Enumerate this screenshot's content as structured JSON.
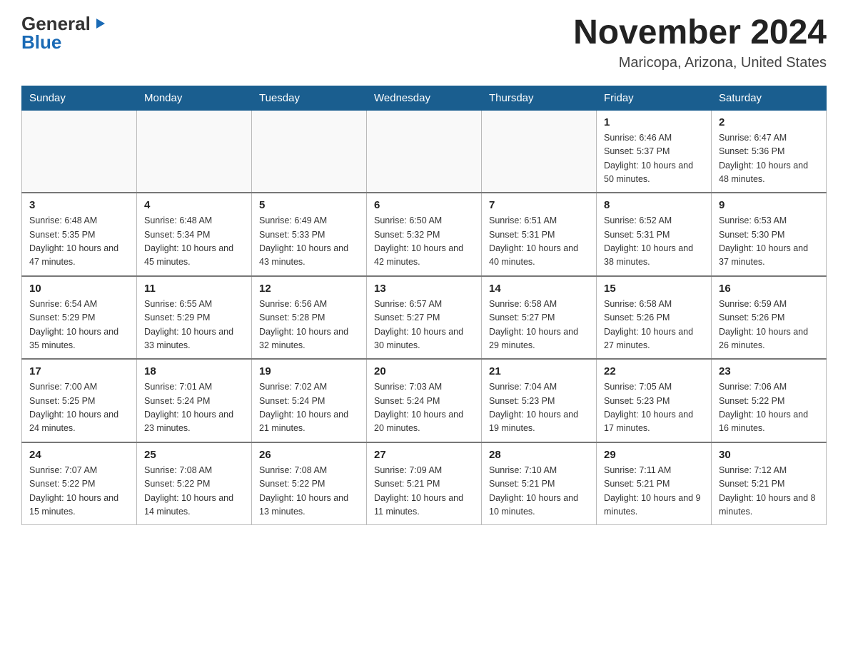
{
  "header": {
    "logo_general": "General",
    "logo_blue": "Blue",
    "title": "November 2024",
    "location": "Maricopa, Arizona, United States"
  },
  "calendar": {
    "days_of_week": [
      "Sunday",
      "Monday",
      "Tuesday",
      "Wednesday",
      "Thursday",
      "Friday",
      "Saturday"
    ],
    "weeks": [
      [
        {
          "day": "",
          "info": ""
        },
        {
          "day": "",
          "info": ""
        },
        {
          "day": "",
          "info": ""
        },
        {
          "day": "",
          "info": ""
        },
        {
          "day": "",
          "info": ""
        },
        {
          "day": "1",
          "info": "Sunrise: 6:46 AM\nSunset: 5:37 PM\nDaylight: 10 hours and 50 minutes."
        },
        {
          "day": "2",
          "info": "Sunrise: 6:47 AM\nSunset: 5:36 PM\nDaylight: 10 hours and 48 minutes."
        }
      ],
      [
        {
          "day": "3",
          "info": "Sunrise: 6:48 AM\nSunset: 5:35 PM\nDaylight: 10 hours and 47 minutes."
        },
        {
          "day": "4",
          "info": "Sunrise: 6:48 AM\nSunset: 5:34 PM\nDaylight: 10 hours and 45 minutes."
        },
        {
          "day": "5",
          "info": "Sunrise: 6:49 AM\nSunset: 5:33 PM\nDaylight: 10 hours and 43 minutes."
        },
        {
          "day": "6",
          "info": "Sunrise: 6:50 AM\nSunset: 5:32 PM\nDaylight: 10 hours and 42 minutes."
        },
        {
          "day": "7",
          "info": "Sunrise: 6:51 AM\nSunset: 5:31 PM\nDaylight: 10 hours and 40 minutes."
        },
        {
          "day": "8",
          "info": "Sunrise: 6:52 AM\nSunset: 5:31 PM\nDaylight: 10 hours and 38 minutes."
        },
        {
          "day": "9",
          "info": "Sunrise: 6:53 AM\nSunset: 5:30 PM\nDaylight: 10 hours and 37 minutes."
        }
      ],
      [
        {
          "day": "10",
          "info": "Sunrise: 6:54 AM\nSunset: 5:29 PM\nDaylight: 10 hours and 35 minutes."
        },
        {
          "day": "11",
          "info": "Sunrise: 6:55 AM\nSunset: 5:29 PM\nDaylight: 10 hours and 33 minutes."
        },
        {
          "day": "12",
          "info": "Sunrise: 6:56 AM\nSunset: 5:28 PM\nDaylight: 10 hours and 32 minutes."
        },
        {
          "day": "13",
          "info": "Sunrise: 6:57 AM\nSunset: 5:27 PM\nDaylight: 10 hours and 30 minutes."
        },
        {
          "day": "14",
          "info": "Sunrise: 6:58 AM\nSunset: 5:27 PM\nDaylight: 10 hours and 29 minutes."
        },
        {
          "day": "15",
          "info": "Sunrise: 6:58 AM\nSunset: 5:26 PM\nDaylight: 10 hours and 27 minutes."
        },
        {
          "day": "16",
          "info": "Sunrise: 6:59 AM\nSunset: 5:26 PM\nDaylight: 10 hours and 26 minutes."
        }
      ],
      [
        {
          "day": "17",
          "info": "Sunrise: 7:00 AM\nSunset: 5:25 PM\nDaylight: 10 hours and 24 minutes."
        },
        {
          "day": "18",
          "info": "Sunrise: 7:01 AM\nSunset: 5:24 PM\nDaylight: 10 hours and 23 minutes."
        },
        {
          "day": "19",
          "info": "Sunrise: 7:02 AM\nSunset: 5:24 PM\nDaylight: 10 hours and 21 minutes."
        },
        {
          "day": "20",
          "info": "Sunrise: 7:03 AM\nSunset: 5:24 PM\nDaylight: 10 hours and 20 minutes."
        },
        {
          "day": "21",
          "info": "Sunrise: 7:04 AM\nSunset: 5:23 PM\nDaylight: 10 hours and 19 minutes."
        },
        {
          "day": "22",
          "info": "Sunrise: 7:05 AM\nSunset: 5:23 PM\nDaylight: 10 hours and 17 minutes."
        },
        {
          "day": "23",
          "info": "Sunrise: 7:06 AM\nSunset: 5:22 PM\nDaylight: 10 hours and 16 minutes."
        }
      ],
      [
        {
          "day": "24",
          "info": "Sunrise: 7:07 AM\nSunset: 5:22 PM\nDaylight: 10 hours and 15 minutes."
        },
        {
          "day": "25",
          "info": "Sunrise: 7:08 AM\nSunset: 5:22 PM\nDaylight: 10 hours and 14 minutes."
        },
        {
          "day": "26",
          "info": "Sunrise: 7:08 AM\nSunset: 5:22 PM\nDaylight: 10 hours and 13 minutes."
        },
        {
          "day": "27",
          "info": "Sunrise: 7:09 AM\nSunset: 5:21 PM\nDaylight: 10 hours and 11 minutes."
        },
        {
          "day": "28",
          "info": "Sunrise: 7:10 AM\nSunset: 5:21 PM\nDaylight: 10 hours and 10 minutes."
        },
        {
          "day": "29",
          "info": "Sunrise: 7:11 AM\nSunset: 5:21 PM\nDaylight: 10 hours and 9 minutes."
        },
        {
          "day": "30",
          "info": "Sunrise: 7:12 AM\nSunset: 5:21 PM\nDaylight: 10 hours and 8 minutes."
        }
      ]
    ]
  }
}
